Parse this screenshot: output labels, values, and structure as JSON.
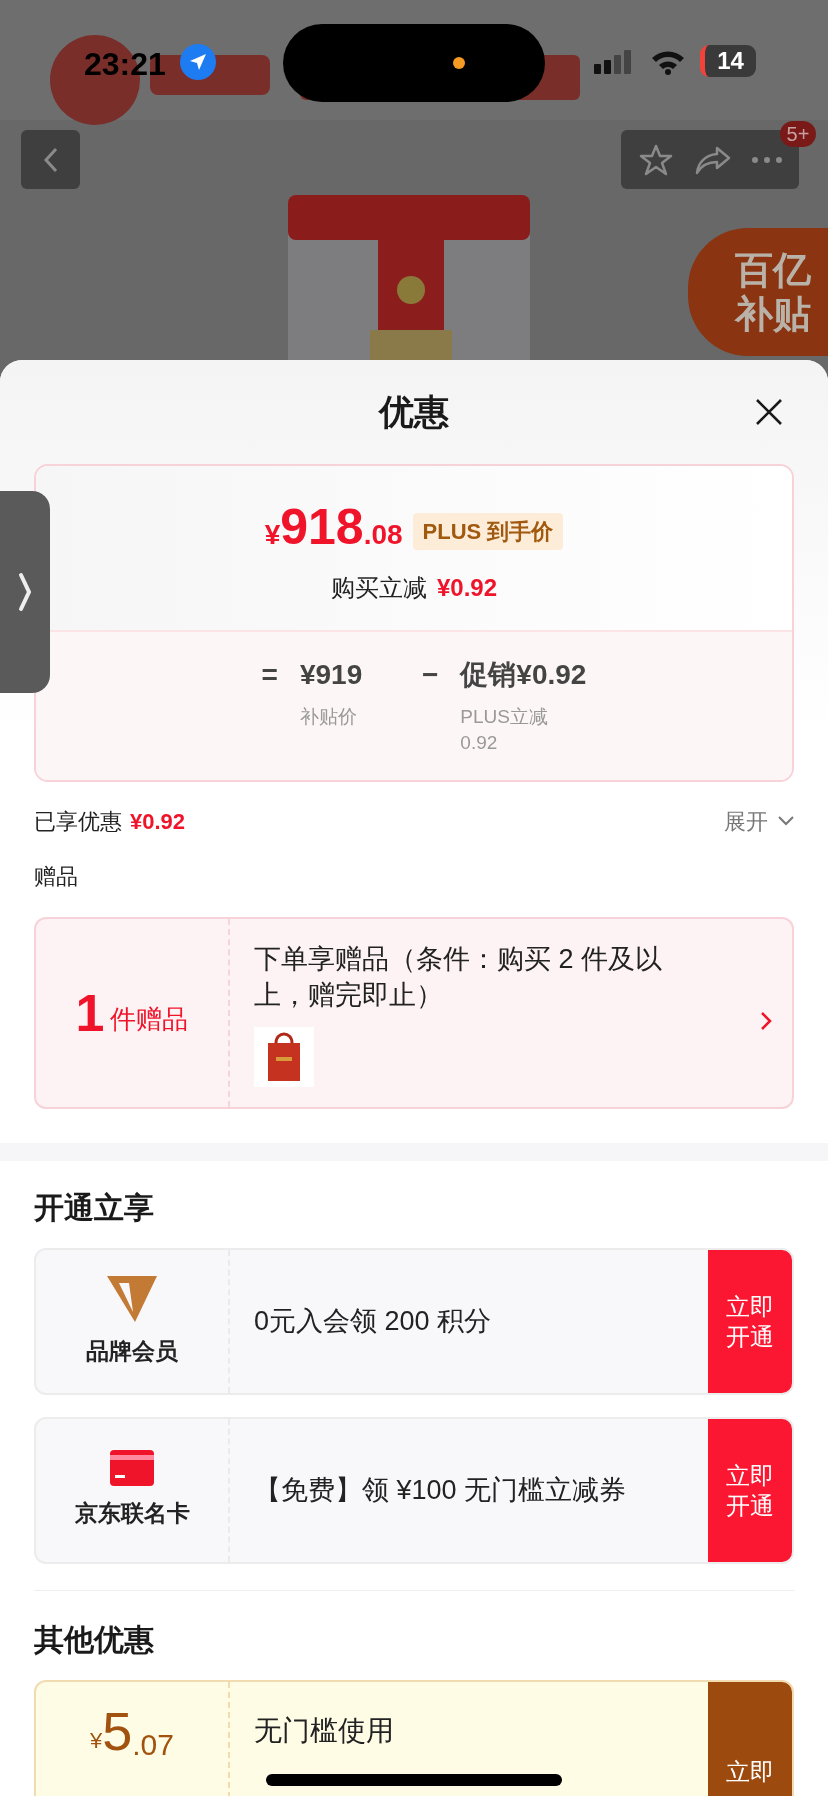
{
  "status_bar": {
    "time": "23:21",
    "battery": "14"
  },
  "nav": {
    "badge": "5+"
  },
  "subsidy_badge": {
    "lines": [
      "百亿",
      "补贴"
    ]
  },
  "sheet": {
    "title": "优惠"
  },
  "price": {
    "symbol": "¥",
    "integer": "918",
    "decimal": ".08",
    "tag": "PLUS 到手价",
    "reduce_label": "购买立减",
    "reduce_amount": "¥0.92",
    "operators": [
      "=",
      "−"
    ],
    "breakdown": [
      {
        "value": "¥919",
        "label": "补贴价"
      },
      {
        "value": "促销¥0.92",
        "label": "PLUS立减 0.92"
      }
    ]
  },
  "enjoyed": {
    "label": "已享优惠",
    "amount": "¥0.92",
    "toggle": "展开",
    "expanded": false
  },
  "gift": {
    "heading": "赠品",
    "count": "1",
    "unit": "件赠品",
    "description": "下单享赠品（条件：购买 2 件及以上，赠完即止）"
  },
  "membership": {
    "heading": "开通立享",
    "offers": [
      {
        "kind": "brand",
        "name": "品牌会员",
        "text": "0元入会领 200 积分",
        "action": "立即开通"
      },
      {
        "kind": "card",
        "name": "京东联名卡",
        "text": "【免费】领 ¥100 无门槛立减券",
        "action": "立即开通"
      }
    ]
  },
  "other": {
    "heading": "其他优惠",
    "coupons": [
      {
        "symbol": "¥",
        "integer": "5",
        "decimal": ".07",
        "text": "无门槛使用",
        "action": "立即"
      }
    ]
  }
}
